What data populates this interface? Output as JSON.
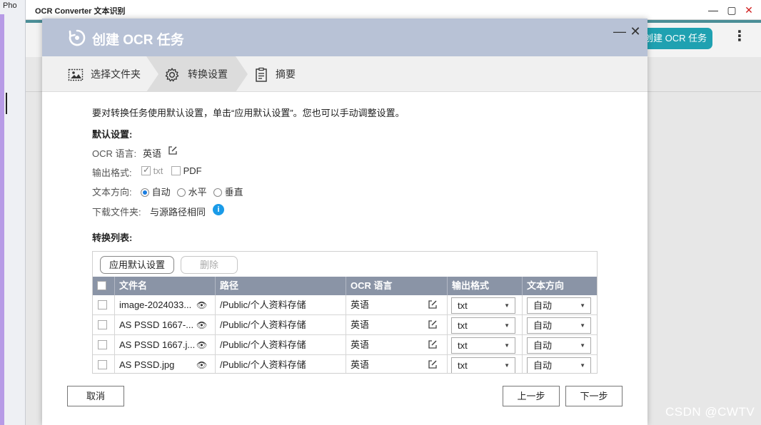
{
  "desktop": {
    "left_title": "Pho"
  },
  "window": {
    "title": "OCR Converter 文本识别",
    "min_glyph": "—",
    "max_glyph": "▢",
    "close_glyph": "✕"
  },
  "app": {
    "create_button": "创建 OCR 任务",
    "more_glyph": "⋮"
  },
  "dialog": {
    "title": "创建 OCR 任务",
    "min_glyph": "—",
    "close_glyph": "✕",
    "steps": [
      {
        "label": "选择文件夹",
        "icon": "image-folder-icon"
      },
      {
        "label": "转换设置",
        "icon": "gear-icon"
      },
      {
        "label": "摘要",
        "icon": "clipboard-icon"
      }
    ],
    "intro": "要对转换任务使用默认设置，单击“应用默认设置”。您也可以手动调整设置。",
    "defaults": {
      "heading": "默认设置:",
      "ocr_lang_label": "OCR 语言:",
      "ocr_lang_value": "英语",
      "output_label": "输出格式:",
      "output_txt": "txt",
      "output_pdf": "PDF",
      "direction_label": "文本方向:",
      "direction_auto": "自动",
      "direction_horizontal": "水平",
      "direction_vertical": "垂直",
      "download_label": "下载文件夹:",
      "download_value": "与源路径相同",
      "info_glyph": "i"
    },
    "list": {
      "heading": "转换列表:",
      "apply_button": "应用默认设置",
      "delete_button": "删除",
      "columns": [
        "文件名",
        "路径",
        "OCR 语言",
        "输出格式",
        "文本方向"
      ],
      "rows": [
        {
          "filename": "image-2024033...",
          "path": "/Public/个人资料存储",
          "lang": "英语",
          "format": "txt",
          "direction": "自动"
        },
        {
          "filename": "AS PSSD 1667-...",
          "path": "/Public/个人资料存储",
          "lang": "英语",
          "format": "txt",
          "direction": "自动"
        },
        {
          "filename": "AS PSSD 1667.j...",
          "path": "/Public/个人资料存储",
          "lang": "英语",
          "format": "txt",
          "direction": "自动"
        },
        {
          "filename": "AS PSSD.jpg",
          "path": "/Public/个人资料存储",
          "lang": "英语",
          "format": "txt",
          "direction": "自动"
        }
      ],
      "eye_glyph": "👁",
      "caret_glyph": "▼"
    },
    "footer": {
      "cancel": "取消",
      "prev": "上一步",
      "next": "下一步"
    }
  },
  "watermark": "CSDN @CWTV"
}
